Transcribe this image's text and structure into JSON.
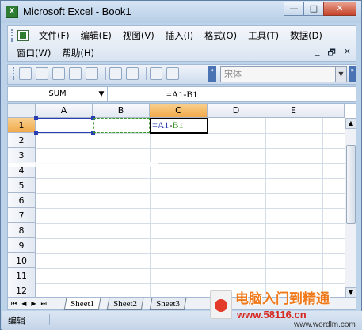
{
  "window": {
    "title": "Microsoft Excel - Book1",
    "app_icon_glyph": "X",
    "controls": {
      "minimize": "—",
      "maximize": "□",
      "close": "✕"
    }
  },
  "menubar": {
    "row1": [
      {
        "label": "文件(F)"
      },
      {
        "label": "编辑(E)"
      },
      {
        "label": "视图(V)"
      },
      {
        "label": "插入(I)"
      },
      {
        "label": "格式(O)"
      },
      {
        "label": "工具(T)"
      },
      {
        "label": "数据(D)"
      }
    ],
    "row2": [
      {
        "label": "窗口(W)"
      },
      {
        "label": "帮助(H)"
      }
    ],
    "mdi_controls": {
      "minimize": "_",
      "restore": "🗗",
      "close": "×"
    }
  },
  "toolbar": {
    "font_name": "宋体",
    "more_glyph": "»"
  },
  "formula_bar": {
    "name_box": "SUM",
    "formula": "=A1-B1"
  },
  "grid": {
    "columns": [
      "A",
      "B",
      "C",
      "D",
      "E"
    ],
    "rows": [
      "1",
      "2",
      "3",
      "4",
      "5",
      "6",
      "7",
      "8",
      "9",
      "10",
      "11",
      "12"
    ],
    "selected_column": "C",
    "selected_row": "1",
    "cell_c1": {
      "part1": "=A1",
      "op": "-",
      "part2": "B1"
    }
  },
  "sheets": {
    "tabs": [
      "Sheet1",
      "Sheet2",
      "Sheet3"
    ],
    "active": "Sheet1",
    "nav": [
      "⏮",
      "◀",
      "▶",
      "⏭"
    ]
  },
  "status": {
    "mode": "编辑"
  },
  "watermark": {
    "site_cn": "电脑入门到精通",
    "url": "www.58116.cn",
    "url2": "www.wordlm.com"
  },
  "colors": {
    "ref_a": "#2a3db3",
    "ref_b": "#3a9a2a",
    "header_selected": "#f1a94a",
    "brand_orange": "#f07a1a",
    "brand_red": "#d7261e"
  }
}
